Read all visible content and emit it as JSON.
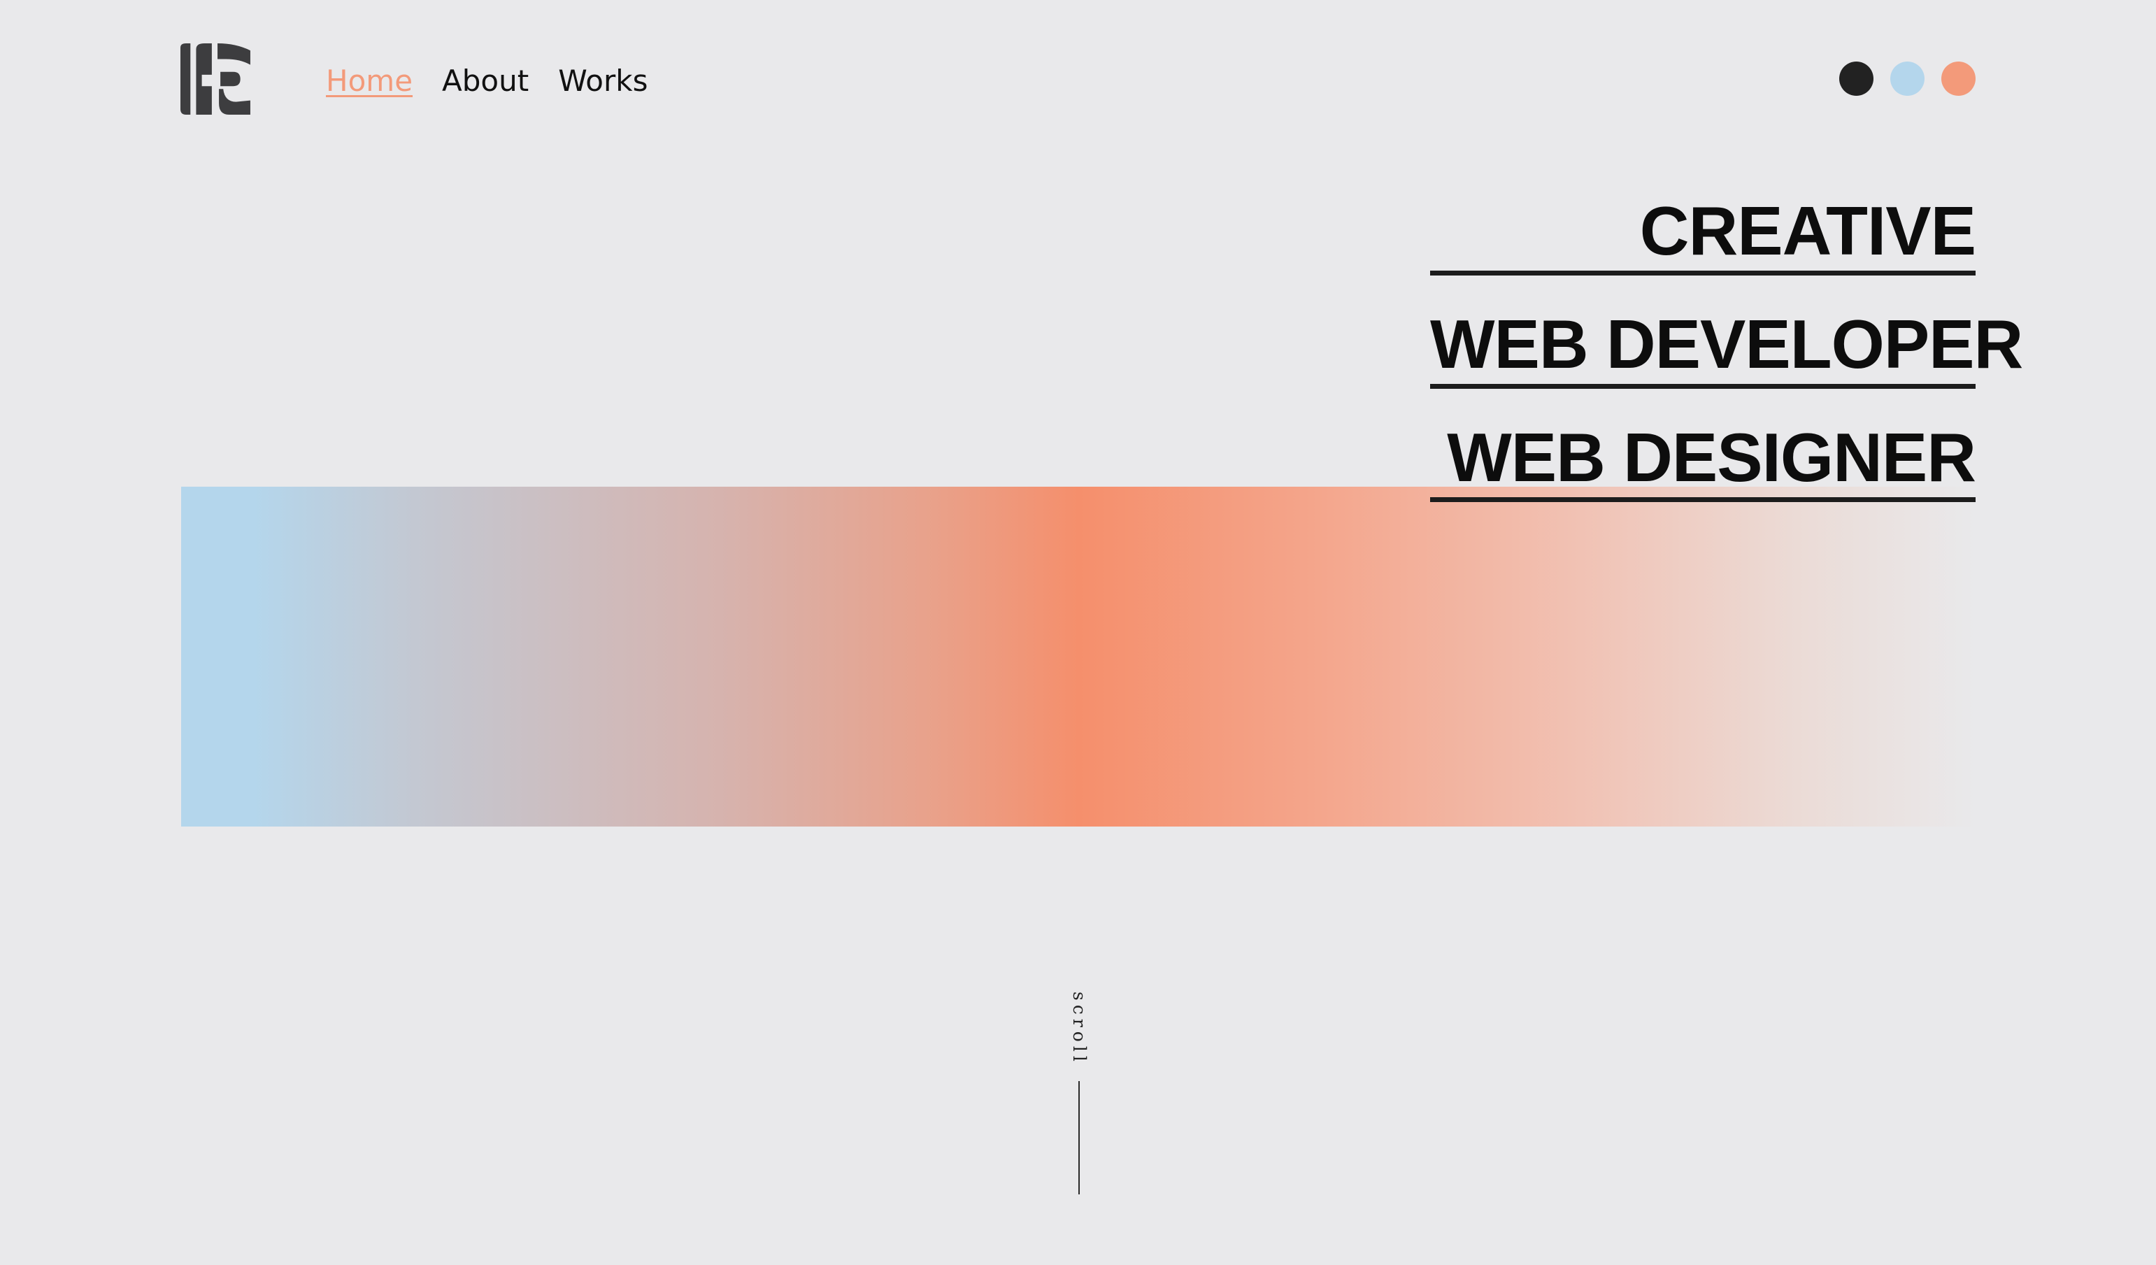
{
  "header": {
    "logo_icon": "fc-monogram-logo",
    "nav": [
      {
        "label": "Home",
        "active": true
      },
      {
        "label": "About",
        "active": false
      },
      {
        "label": "Works",
        "active": false
      }
    ],
    "theme_colors": [
      "#222222",
      "#b4d6ec",
      "#f39a7a"
    ]
  },
  "hero": {
    "lines": [
      "CREATIVE",
      "WEB DEVELOPER",
      "WEB DESIGNER"
    ]
  },
  "scroll": {
    "label": "scroll"
  },
  "colors": {
    "background": "#e9e9eb",
    "accent": "#f39a7a",
    "blue": "#b4d6ec",
    "dark": "#222222"
  }
}
